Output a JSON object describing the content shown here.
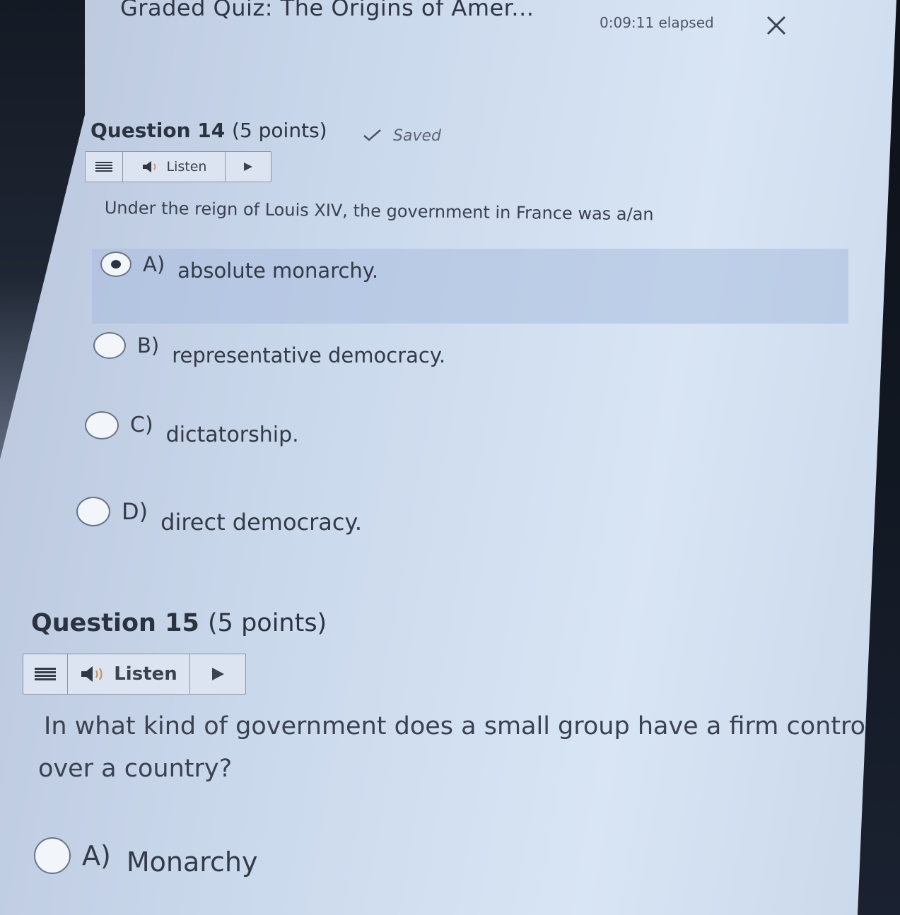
{
  "header": {
    "title": "Graded Quiz: The Origins of Amer...",
    "elapsed": "0:09:11 elapsed"
  },
  "questions": [
    {
      "heading": "Question 14",
      "points": "(5 points)",
      "saved_label": "Saved",
      "listen_label": "Listen",
      "text": "Under the reign of Louis XIV, the government in France was a/an",
      "options": [
        {
          "letter": "A)",
          "text": "absolute monarchy.",
          "selected": true
        },
        {
          "letter": "B)",
          "text": "representative democracy.",
          "selected": false
        },
        {
          "letter": "C)",
          "text": "dictatorship.",
          "selected": false
        },
        {
          "letter": "D)",
          "text": "direct democracy.",
          "selected": false
        }
      ]
    },
    {
      "heading": "Question 15",
      "points": "(5 points)",
      "listen_label": "Listen",
      "text_line1": "In what kind of government does a small group have a firm control",
      "text_line2": "over a country?",
      "options": [
        {
          "letter": "A)",
          "text": "Monarchy",
          "selected": false
        }
      ]
    }
  ],
  "icons": {
    "close": "close-icon",
    "menu": "menu-lines-icon",
    "speaker": "speaker-icon",
    "play": "play-icon",
    "check": "check-icon"
  },
  "colors": {
    "background": "#cfdcee",
    "selected_band": "#aabede",
    "text": "#333a48"
  }
}
